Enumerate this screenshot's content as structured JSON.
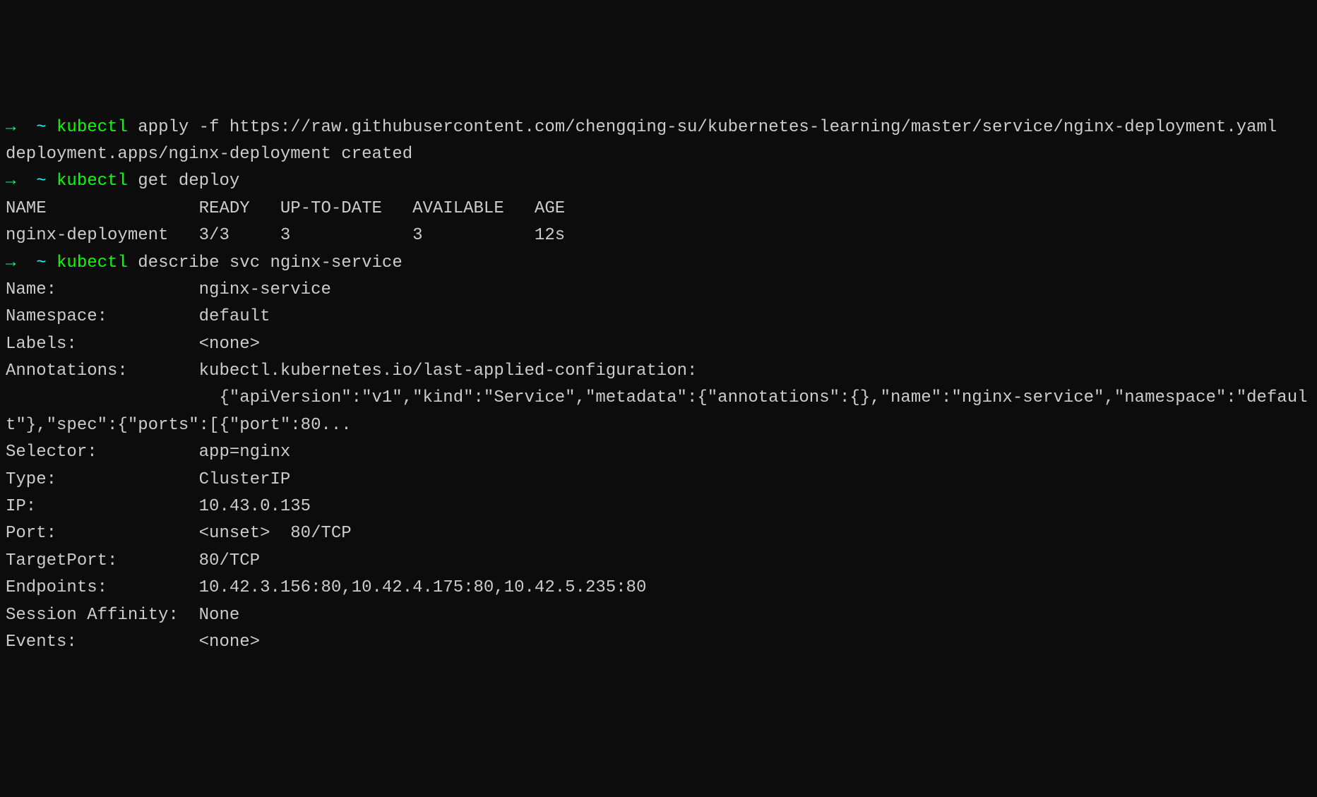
{
  "prompt_arrow": "→",
  "prompt_tilde": "~",
  "kubectl": "kubectl",
  "cmd1_args": " apply -f https://raw.githubusercontent.com/chengqing-su/kubernetes-learning/master/service/nginx-deployment.yaml",
  "out1": "deployment.apps/nginx-deployment created",
  "cmd2_args": " get deploy",
  "table_header": "NAME               READY   UP-TO-DATE   AVAILABLE   AGE",
  "table_row": "nginx-deployment   3/3     3            3           12s",
  "cmd3_args": " describe svc nginx-service",
  "svc": {
    "name_label": "Name:",
    "name_value": "nginx-service",
    "namespace_label": "Namespace:",
    "namespace_value": "default",
    "labels_label": "Labels:",
    "labels_value": "<none>",
    "annotations_label": "Annotations:",
    "annotations_value": "kubectl.kubernetes.io/last-applied-configuration:",
    "annotations_json": "                     {\"apiVersion\":\"v1\",\"kind\":\"Service\",\"metadata\":{\"annotations\":{},\"name\":\"nginx-service\",\"namespace\":\"default\"},\"spec\":{\"ports\":[{\"port\":80...",
    "selector_label": "Selector:",
    "selector_value": "app=nginx",
    "type_label": "Type:",
    "type_value": "ClusterIP",
    "ip_label": "IP:",
    "ip_value": "10.43.0.135",
    "port_label": "Port:",
    "port_value": "<unset>  80/TCP",
    "targetport_label": "TargetPort:",
    "targetport_value": "80/TCP",
    "endpoints_label": "Endpoints:",
    "endpoints_value": "10.42.3.156:80,10.42.4.175:80,10.42.5.235:80",
    "session_label": "Session Affinity:",
    "session_value": "None",
    "events_label": "Events:",
    "events_value": "<none>"
  }
}
